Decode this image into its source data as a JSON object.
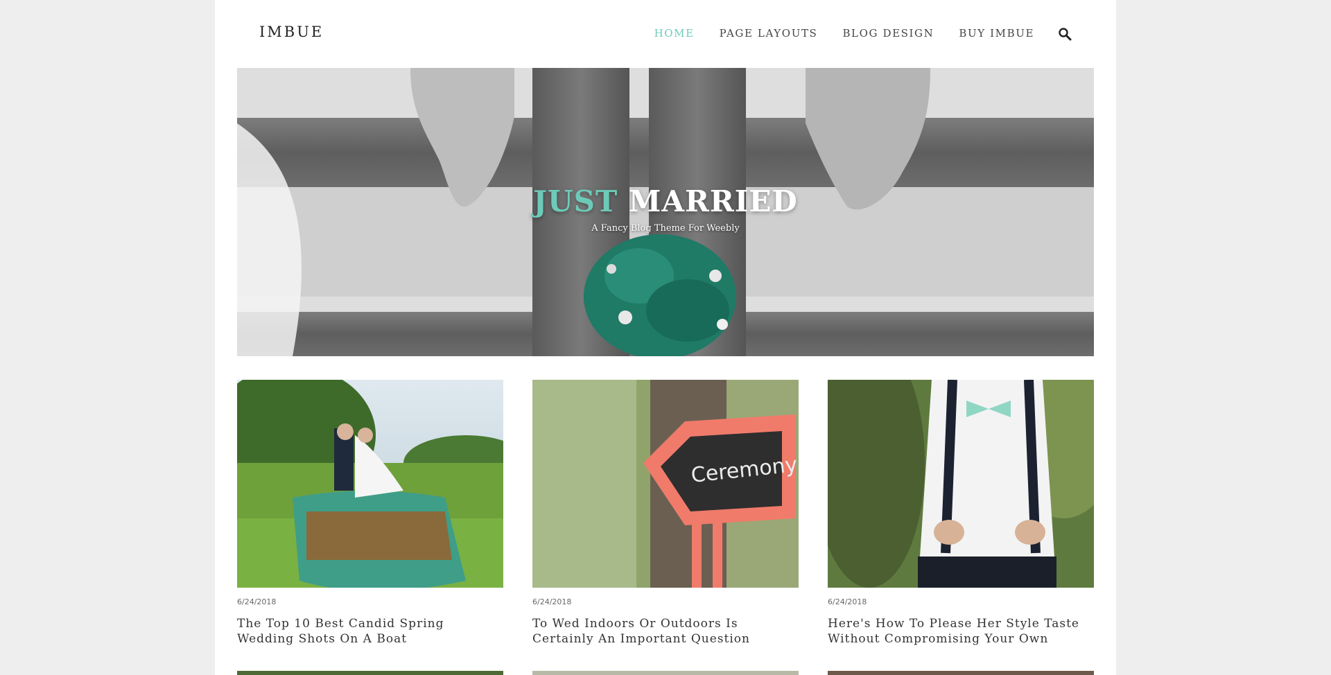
{
  "header": {
    "logo": "IMBUE",
    "nav": [
      {
        "label": "HOME",
        "active": true
      },
      {
        "label": "PAGE LAYOUTS",
        "active": false
      },
      {
        "label": "BLOG DESIGN",
        "active": false
      },
      {
        "label": "BUY IMBUE",
        "active": false
      }
    ],
    "search_icon": "search-icon"
  },
  "hero": {
    "title_accent": "JUST",
    "title_rest": "MARRIED",
    "subtitle": "A Fancy Blog Theme For Weebly"
  },
  "posts": [
    {
      "date": "6/24/2018",
      "title": "The Top 10 Best Candid Spring Wedding Shots On A Boat"
    },
    {
      "date": "6/24/2018",
      "title": "To Wed Indoors Or Outdoors Is Certainly An Important Question"
    },
    {
      "date": "6/24/2018",
      "title": "Here's How To Please Her Style Taste Without Compromising Your Own"
    }
  ],
  "colors": {
    "accent": "#6ccbb8",
    "background": "#eeeeee",
    "page": "#ffffff"
  }
}
